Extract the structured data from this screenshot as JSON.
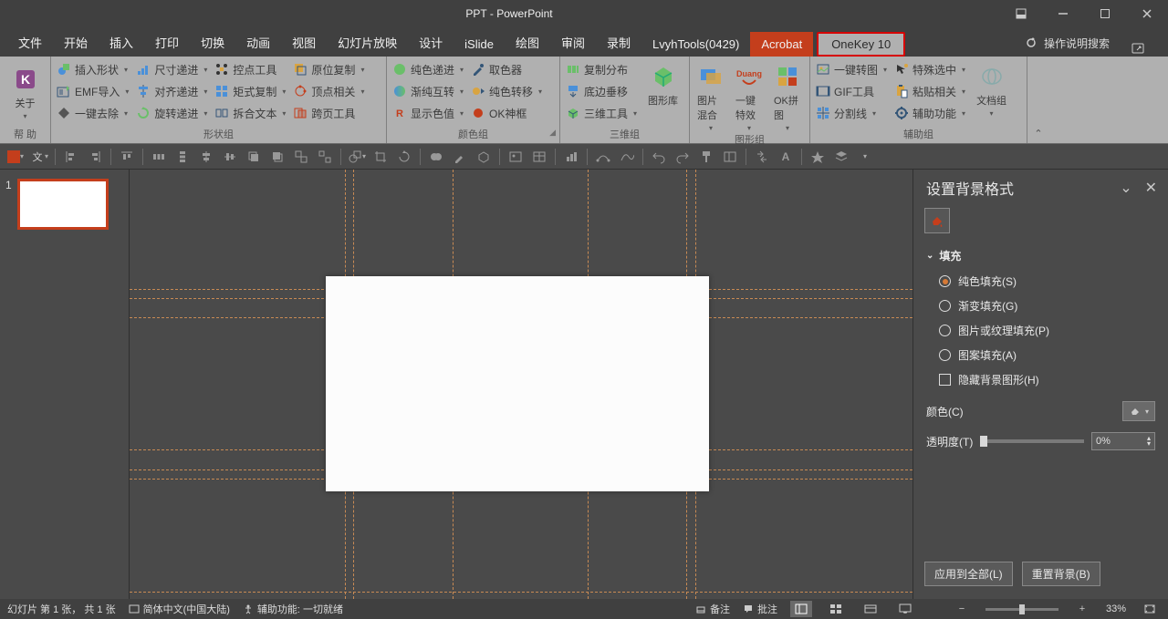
{
  "title": "PPT  -  PowerPoint",
  "tabs": [
    "文件",
    "开始",
    "插入",
    "打印",
    "切换",
    "动画",
    "视图",
    "幻灯片放映",
    "设计",
    "iSlide",
    "绘图",
    "审阅",
    "录制",
    "LvyhTools(0429)",
    "Acrobat",
    "OneKey 10"
  ],
  "tellme": "操作说明搜索",
  "ribbon": {
    "help": {
      "label": "帮 助",
      "about": "关于"
    },
    "shape": {
      "label": "形状组",
      "col1": [
        "插入形状",
        "EMF导入",
        "一键去除"
      ],
      "col2": [
        "尺寸递进",
        "对齐递进",
        "旋转递进"
      ],
      "col3": [
        "控点工具",
        "矩式复制",
        "拆合文本"
      ],
      "col4": [
        "原位复制",
        "顶点相关",
        "跨页工具"
      ]
    },
    "color": {
      "label": "颜色组",
      "col1": [
        "纯色递进",
        "渐纯互转",
        "显示色值"
      ],
      "col2": [
        "取色器",
        "纯色转移",
        "OK神框"
      ]
    },
    "threed": {
      "label": "三维组",
      "col1": [
        "复制分布",
        "底边垂移",
        "三维工具"
      ],
      "lib": "图形库"
    },
    "graphic": {
      "label": "图形组",
      "mix": "图片混合",
      "fx": "一键特效",
      "ok": "OK拼图"
    },
    "aux": {
      "label": "辅助组",
      "col1": [
        "一键转图",
        "GIF工具",
        "分割线"
      ],
      "col2": [
        "特殊选中",
        "粘贴相关",
        "辅助功能"
      ],
      "doc": "文档组"
    }
  },
  "pane": {
    "title": "设置背景格式",
    "section": "填充",
    "opts": [
      "纯色填充(S)",
      "渐变填充(G)",
      "图片或纹理填充(P)",
      "图案填充(A)"
    ],
    "hide": "隐藏背景图形(H)",
    "color_label": "颜色(C)",
    "trans_label": "透明度(T)",
    "trans_value": "0%",
    "apply_all": "应用到全部(L)",
    "reset": "重置背景(B)"
  },
  "status": {
    "slide": "幻灯片 第 1 张， 共 1 张",
    "lang": "简体中文(中国大陆)",
    "access": "辅助功能: 一切就绪",
    "notes": "备注",
    "comments": "批注",
    "zoom": "33%"
  },
  "thumb_num": "1"
}
